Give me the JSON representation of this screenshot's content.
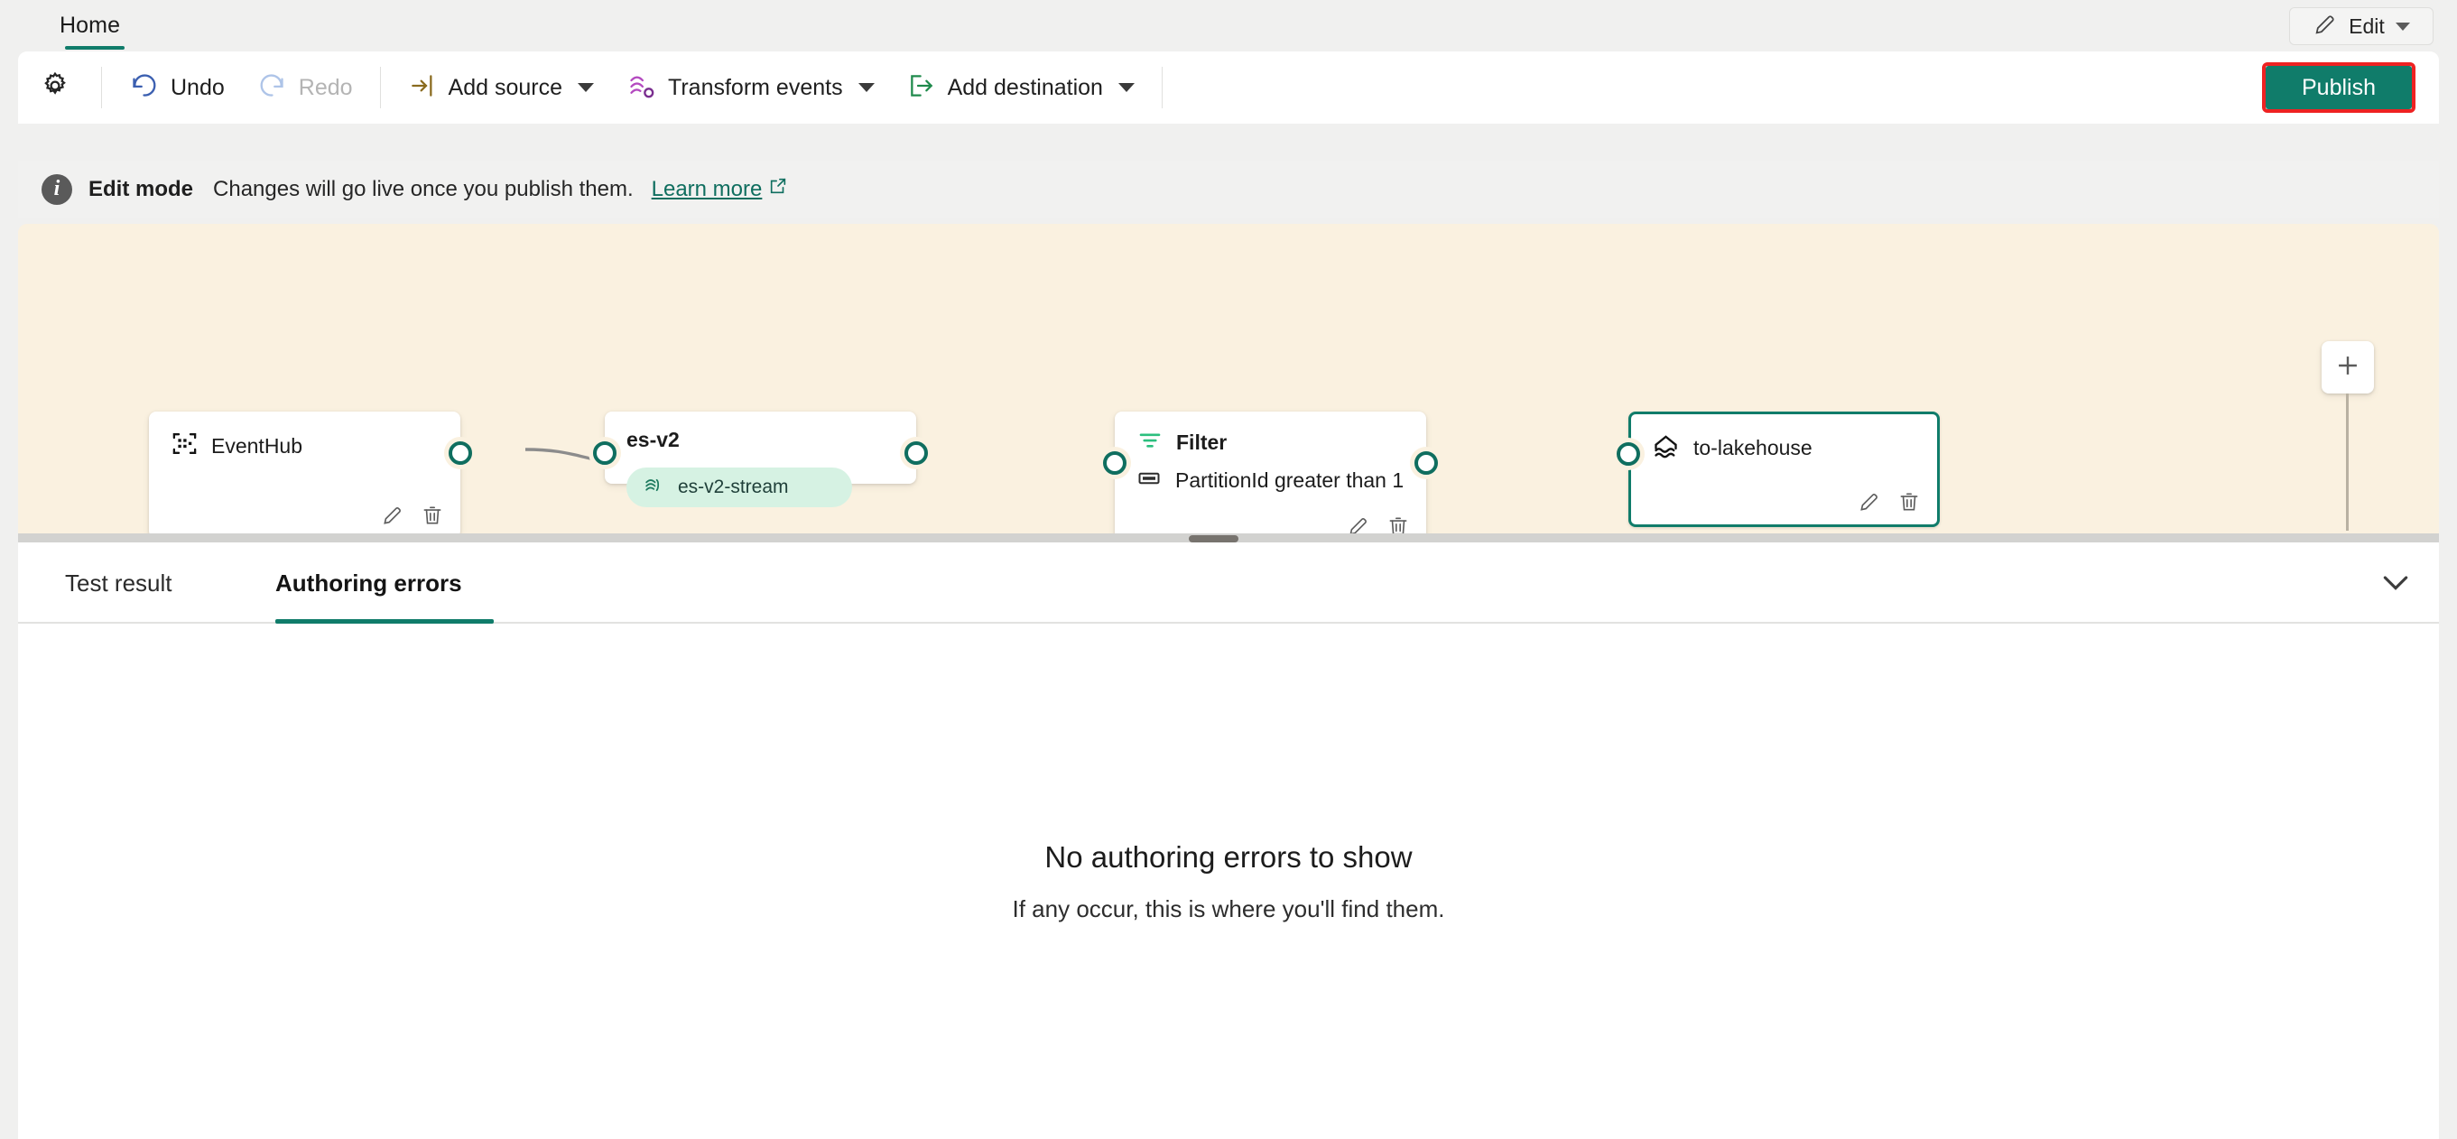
{
  "colors": {
    "accent_teal": "#107c6a",
    "canvas_bg": "#faf1e0",
    "publish_bg": "#107c6a",
    "highlight_red": "#ee2222",
    "pill_bg": "#d6f2e3",
    "undo_blue": "#3b5fb0",
    "redo_disabled": "#aec4e8",
    "source_gold": "#8a6b1f",
    "transform_purple": "#b44ac0",
    "destination_green": "#1f8a4c",
    "filter_green": "#2bbf7e",
    "connector_grey": "#8c8c8c"
  },
  "tabstrip": {
    "tabs": [
      {
        "label": "Home",
        "active": true
      }
    ],
    "edit_button": {
      "label": "Edit",
      "icon": "pencil-icon",
      "caret": "chevron-down-icon"
    }
  },
  "toolbar": {
    "settings_icon": "gear-icon",
    "items": [
      {
        "label": "Undo",
        "icon": "undo-arrow-icon",
        "disabled": false,
        "has_caret": false
      },
      {
        "label": "Redo",
        "icon": "redo-arrow-icon",
        "disabled": true,
        "has_caret": false
      },
      {
        "label": "Add source",
        "icon": "add-source-icon",
        "disabled": false,
        "has_caret": true
      },
      {
        "label": "Transform events",
        "icon": "transform-events-icon",
        "disabled": false,
        "has_caret": true
      },
      {
        "label": "Add destination",
        "icon": "add-destination-icon",
        "disabled": false,
        "has_caret": true
      }
    ],
    "publish_label": "Publish"
  },
  "info_bar": {
    "icon": "info-icon",
    "title": "Edit mode",
    "message": "Changes will go live once you publish them.",
    "link_label": "Learn more",
    "link_icon": "external-link-icon"
  },
  "canvas": {
    "add_node_button": {
      "icon": "plus-icon"
    },
    "nodes": [
      {
        "id": "eventhub",
        "title": "EventHub",
        "title_bold": false,
        "icon": "eventhub-icon",
        "selected": false,
        "actions": [
          "pencil-icon",
          "trash-icon"
        ],
        "ports": {
          "input": false,
          "output": true
        }
      },
      {
        "id": "es-v2",
        "title": "es-v2",
        "title_bold": true,
        "icon": null,
        "selected": false,
        "pill": {
          "label": "es-v2-stream",
          "icon": "eventstream-icon"
        },
        "actions": [],
        "ports": {
          "input": true,
          "output": true
        }
      },
      {
        "id": "filter",
        "title": "Filter",
        "title_bold": true,
        "icon": "filter-icon",
        "selected": false,
        "condition": {
          "label": "PartitionId greater than 1",
          "icon": "field-icon"
        },
        "actions": [
          "pencil-icon",
          "trash-icon"
        ],
        "ports": {
          "input": true,
          "output": true
        }
      },
      {
        "id": "to-lakehouse",
        "title": "to-lakehouse",
        "title_bold": false,
        "icon": "lakehouse-icon",
        "selected": true,
        "actions": [
          "pencil-icon",
          "trash-icon"
        ],
        "ports": {
          "input": true,
          "output": false
        }
      }
    ]
  },
  "bottom_panel": {
    "tabs": [
      {
        "label": "Test result",
        "active": false
      },
      {
        "label": "Authoring errors",
        "active": true
      }
    ],
    "collapse_icon": "chevron-down-icon",
    "empty_state": {
      "title": "No authoring errors to show",
      "subtitle": "If any occur, this is where you'll find them."
    }
  }
}
